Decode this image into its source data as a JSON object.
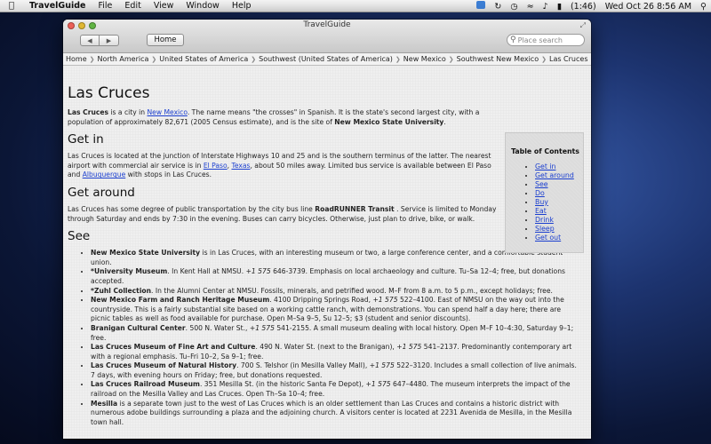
{
  "menubar": {
    "app_name": "TravelGuide",
    "items": [
      "File",
      "Edit",
      "View",
      "Window",
      "Help"
    ],
    "battery": "(1:46)",
    "datetime": "Wed Oct 26  8:56 AM"
  },
  "window": {
    "title": "TravelGuide",
    "home_label": "Home",
    "search_placeholder": "Place search",
    "breadcrumbs": [
      "Home",
      "North America",
      "United States of America",
      "Southwest (United States of America)",
      "New Mexico",
      "Southwest New Mexico",
      "Las Cruces"
    ]
  },
  "article": {
    "title": "Las Cruces",
    "intro": {
      "b1": "Las Cruces",
      "t1": " is a city in ",
      "link1": "New Mexico",
      "t2": ". The name means \"the crosses\" in Spanish. It is the state's second largest city, with a population of approximately 82,671 (2005 Census estimate), and is the site of ",
      "b2": "New Mexico State University",
      "t3": "."
    },
    "get_in": {
      "heading": "Get in",
      "t1": "Las Cruces is located at the junction of Interstate Highways 10 and 25 and is the southern terminus of the latter. The nearest airport with commercial air service is in ",
      "link1": "El Paso",
      "t2": ", ",
      "link2": "Texas",
      "t3": ", about 50 miles away. Limited bus service is available between El Paso and ",
      "link3": "Albuquerque",
      "t4": " with stops in Las Cruces."
    },
    "get_around": {
      "heading": "Get around",
      "t1": "Las Cruces has some degree of public transportation by the city bus line ",
      "b1": "RoadRUNNER Transit",
      "t2": " . Service is limited to Monday through Saturday and ends by 7:30 in the evening. Buses can carry bicycles. Otherwise, just plan to drive, bike, or walk."
    },
    "see": {
      "heading": "See",
      "items": [
        {
          "name": "New Mexico State University",
          "phone": "",
          "text": " is in Las Cruces, with an interesting museum or two, a large conference center, and a comfortable student union."
        },
        {
          "name": "*University Museum",
          "phone": "+1 575",
          "text": ". In Kent Hall at NMSU. ",
          "rest": " 646-3739. Emphasis on local archaeology and culture. Tu–Sa 12–4; free, but donations accepted."
        },
        {
          "name": "*Zuhl Collection",
          "phone": "",
          "text": ". In the Alumni Center at NMSU. Fossils, minerals, and petrified wood. M–F from 8 a.m. to 5 p.m., except holidays; free."
        },
        {
          "name": "New Mexico Farm and Ranch Heritage Museum",
          "phone": "+1 575",
          "text": ". 4100 Dripping Springs Road, ",
          "rest": " 522–4100. East of NMSU on the way out into the countryside. This is a fairly substantial site based on a working cattle ranch, with demonstrations. You can spend half a day here; there are picnic tables as well as food available for purchase. Open M–Sa 9–5, Su 12–5; $3 (student and senior discounts)."
        },
        {
          "name": "Branigan Cultural Center",
          "phone": "+1 575",
          "text": ". 500 N. Water St., ",
          "rest": " 541-2155. A small museum dealing with local history. Open M–F 10–4:30, Saturday 9–1; free."
        },
        {
          "name": "Las Cruces Museum of Fine Art and Culture",
          "phone": "+1 575",
          "text": ". 490 N. Water St. (next to the Branigan), ",
          "rest": " 541–2137. Predominantly contemporary art with a regional emphasis. Tu–Fri 10–2, Sa 9–1; free."
        },
        {
          "name": "Las Cruces Museum of Natural History",
          "phone": "+1 575",
          "text": ". 700 S. Telshor (in Mesilla Valley Mall), ",
          "rest": " 522–3120. Includes a small collection of live animals. 7 days, with evening hours on Friday; free, but donations requested."
        },
        {
          "name": "Las Cruces Railroad Museum",
          "phone": "+1 575",
          "text": ". 351 Mesilla St. (in the historic Santa Fe Depot), ",
          "rest": " 647–4480. The museum interprets the impact of the railroad on the Mesilla Valley and Las Cruces. Open Th–Sa 10–4; free."
        },
        {
          "name": "Mesilla",
          "phone": "",
          "text": " is a separate town just to the west of Las Cruces which is an older settlement than Las Cruces and contains a historic district with numerous adobe buildings surrounding a plaza and the adjoining church. A visitors center is located at 2231 Avenida de Mesilla, in the Mesilla town hall."
        }
      ]
    }
  },
  "toc": {
    "title": "Table of Contents",
    "items": [
      "Get in",
      "Get around",
      "See",
      "Do",
      "Buy",
      "Eat",
      "Drink",
      "Sleep",
      "Get out"
    ]
  },
  "colors": {
    "link": "#1a3ecf",
    "close": "#ec5f57",
    "minimize": "#e0b833",
    "zoom": "#60b443"
  }
}
